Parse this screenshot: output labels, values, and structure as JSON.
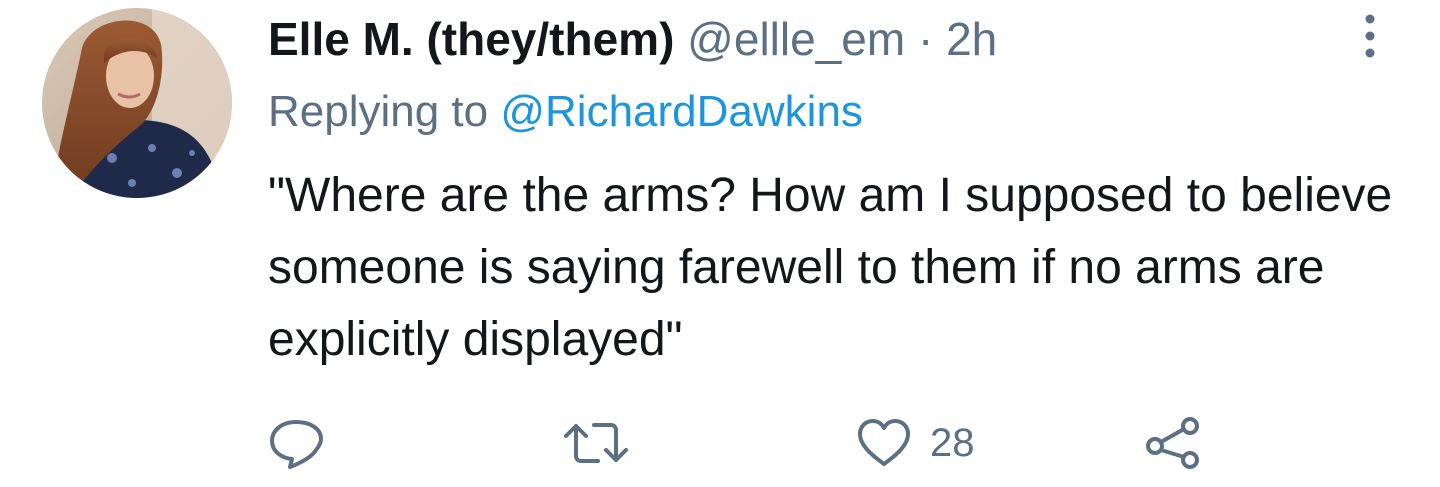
{
  "tweet": {
    "author": {
      "name": "Elle M. (they/them)",
      "handle": "@ellle_em",
      "separator": " · ",
      "time": "2h"
    },
    "replying_prefix": "Replying to ",
    "replying_to": "@RichardDawkins",
    "text": "\"Where are the arms? How am I supposed to believe someone is saying farewell to them if no arms are explicitly displayed\"",
    "actions": {
      "reply_count": "",
      "retweet_count": "",
      "like_count": "28",
      "share_count": ""
    },
    "icons": {
      "reply": "reply-icon",
      "retweet": "retweet-icon",
      "like": "heart-icon",
      "share": "share-icon",
      "more": "more-vertical-icon"
    },
    "colors": {
      "name": "#14171a",
      "secondary": "#5b7083",
      "link": "#1b95e0",
      "background": "#ffffff"
    }
  }
}
